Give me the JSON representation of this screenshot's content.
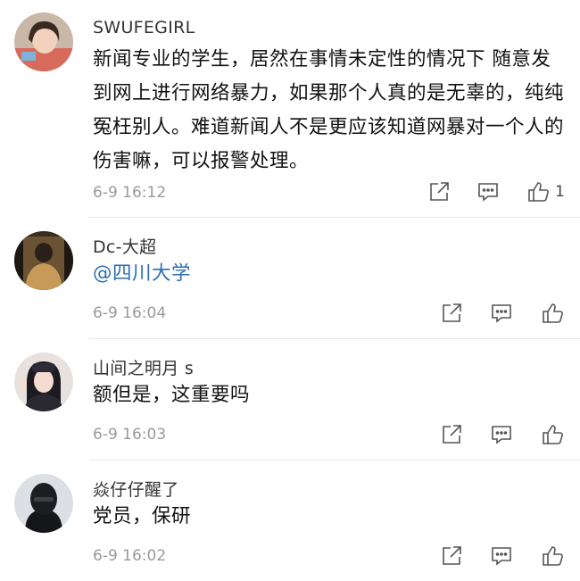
{
  "comments": [
    {
      "user": "SWUFEGIRL",
      "text": "新闻专业的学生，居然在事情未定性的情况下 随意发到网上进行网络暴力，如果那个人真的是无辜的，纯纯冤枉别人。难道新闻人不是更应该知道网暴对一个人的伤害嘛，可以报警处理。",
      "time": "6-9 16:12",
      "likes": "1"
    },
    {
      "user": "Dc-大超",
      "text": "@四川大学",
      "time": "6-9 16:04",
      "likes": ""
    },
    {
      "user": "山间之明月 s",
      "text": "额但是，这重要吗",
      "time": "6-9 16:03",
      "likes": ""
    },
    {
      "user": "焱仔仔醒了",
      "text": "党员，保研",
      "time": "6-9 16:02",
      "likes": ""
    }
  ],
  "icons": {
    "share": "share-icon",
    "comment": "comment-icon",
    "like": "like-icon"
  },
  "colors": {
    "mention": "#2c6db5",
    "meta": "#9a9a9a"
  }
}
